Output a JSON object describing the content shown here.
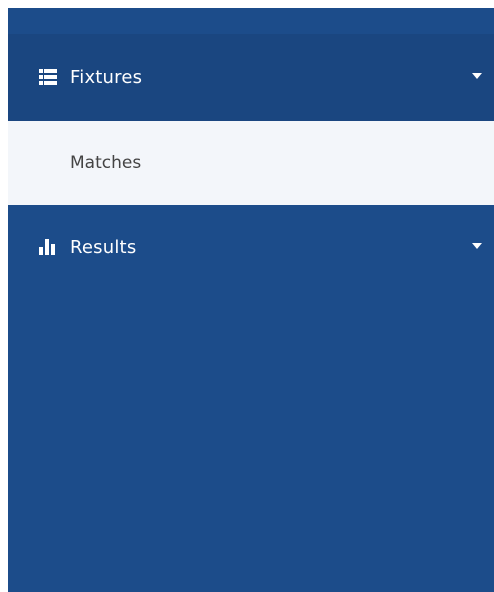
{
  "sidebar": {
    "items": [
      {
        "label": "Fixtures",
        "icon": "list-icon",
        "expanded": true,
        "children": [
          {
            "label": "Matches"
          }
        ]
      },
      {
        "label": "Results",
        "icon": "bar-chart-icon",
        "expanded": false
      }
    ]
  },
  "colors": {
    "sidebar_bg": "#1c4c8a",
    "active_bg": "#1a4680",
    "submenu_bg": "#f3f6fa",
    "text_light": "#ffffff",
    "text_dark": "#444444"
  }
}
